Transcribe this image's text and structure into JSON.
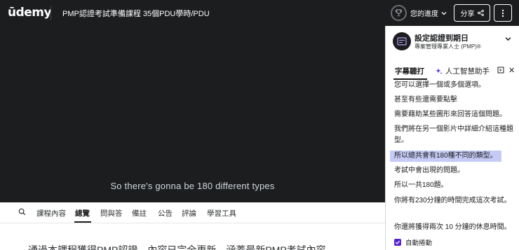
{
  "header": {
    "logo": "ūdemy",
    "course_title": "PMP認證考試準備課程 35個PDU學時/PDU",
    "progress_label": "您的進度",
    "share_label": "分享"
  },
  "video": {
    "caption": "So there's gonna be 180 different types"
  },
  "tabs": {
    "items": [
      "課程內容",
      "總覽",
      "問與答",
      "備註",
      "公告",
      "評論",
      "學習工具"
    ],
    "active": "總覽"
  },
  "content": {
    "clip_text": "通過本課程獲得PMP認證，內容已完全更新，涵蓋最新PMP考試內容"
  },
  "sidebar": {
    "goal_title": "設定認證到期日",
    "goal_subtitle": "專案管理專業人士 (PMP)®",
    "tab_transcript": "字幕聽打",
    "tab_ai": "人工智慧助手",
    "transcript": [
      "您可以選擇一個或多個選項。",
      "甚至有些還需要點擊",
      "需要藉助某些圖形來回答這個問題。",
      "我們將在另一個影片中詳細介紹這種題型。",
      "所以總共會有180種不同的類型。",
      "考試中會出現的問題。",
      "所以一共180題。",
      "你將有230分鐘的時間完成這次考試。",
      "你還將獲得兩次 10 分鐘的休息時間。"
    ],
    "highlighted_index": 4,
    "autoscroll_label": "自動捲動",
    "autoscroll_checked": true
  },
  "colors": {
    "header_bg": "#1c1d1f",
    "accent": "#5624d0",
    "highlight": "#c5cbf5"
  }
}
